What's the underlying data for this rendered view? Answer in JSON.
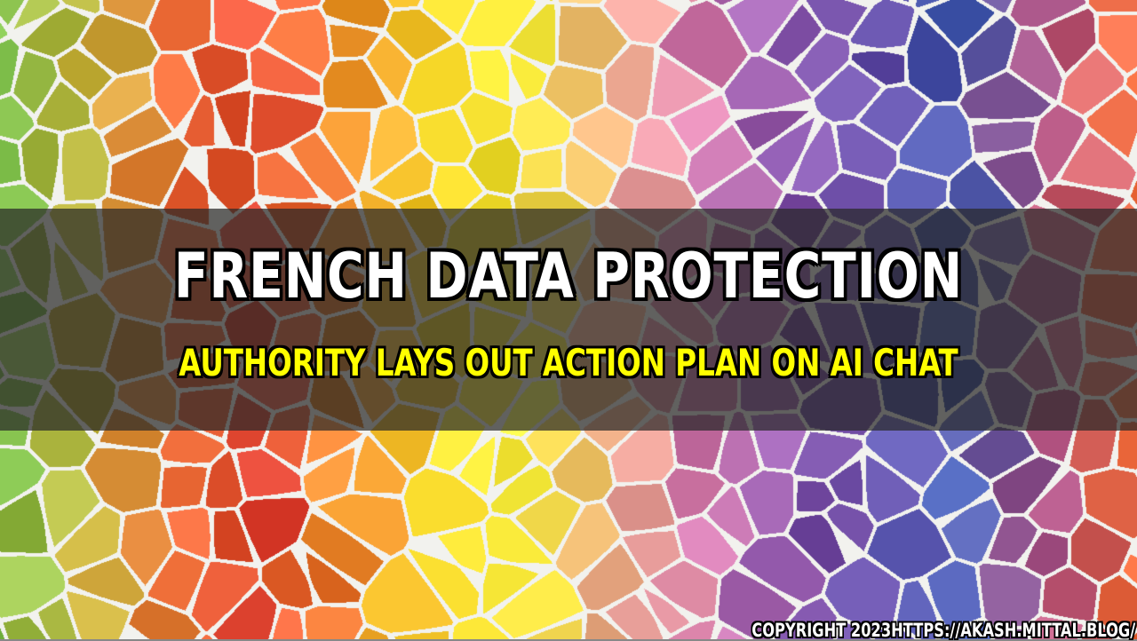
{
  "banner": {
    "headline": "FRENCH DATA PROTECTION",
    "subline": "AUTHORITY LAYS OUT ACTION PLAN ON AI CHAT",
    "copyright": "COPYRIGHT 2023HTTPS://AKASH.MITTAL.BLOG/"
  },
  "background": {
    "pattern": "voronoi-mosaic",
    "gradient_colors": [
      "#84c450",
      "#c6b43c",
      "#eb6e34",
      "#e84a3a",
      "#f0922e",
      "#f6d728",
      "#f8ec3c",
      "#f4b48c",
      "#d87eb0",
      "#8e58ae",
      "#6650aa",
      "#4a62b8",
      "#b85a8a",
      "#ef6a3a"
    ],
    "grout_color": "#f2f2ee"
  },
  "colors": {
    "headline": "#ffffff",
    "subline": "#ffff00",
    "outline": "#000000"
  }
}
